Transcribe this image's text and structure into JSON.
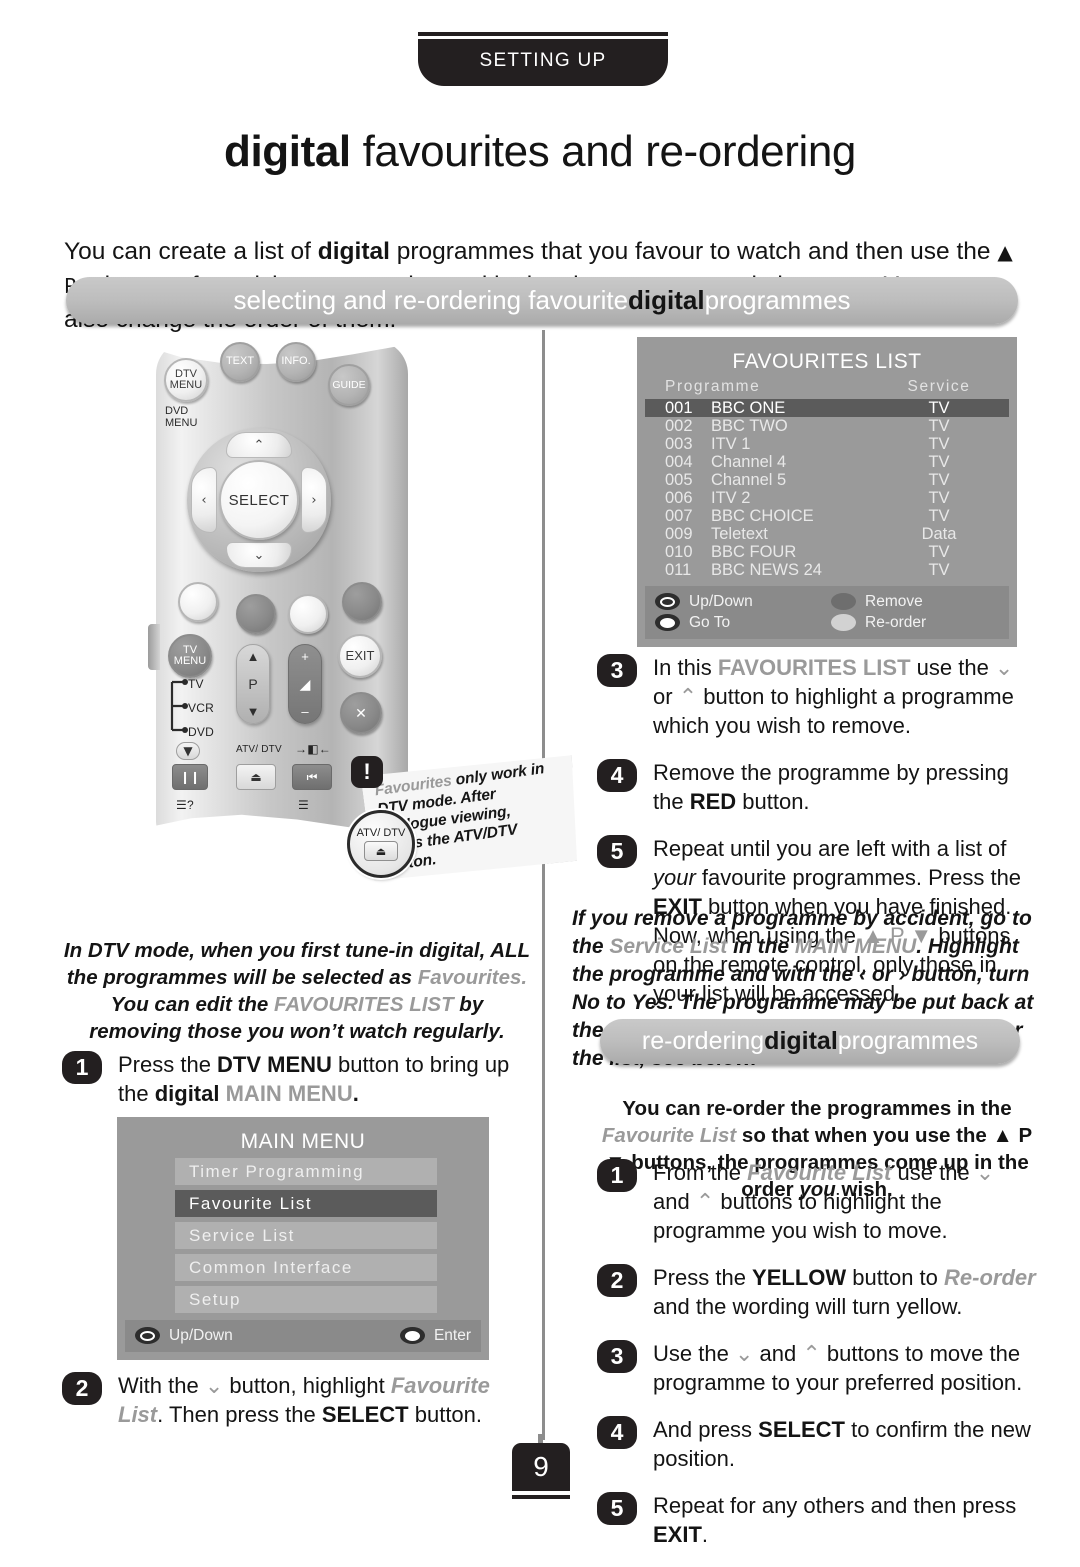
{
  "header": {
    "tab_label": "SETTING UP",
    "title_bold": "digital",
    "title_rest": " favourites and re-ordering"
  },
  "intro": {
    "line1_a": "You can create a list of ",
    "line1_bold": "digital",
    "line1_b": " programmes that you favour to watch and then use the ",
    "line1_glyph": "▲ P ▼",
    "line1_c": " buttons for quick access to them, skipping the programmes in between. You can also change the order of them."
  },
  "banners": {
    "selecting_a": "selecting and re-ordering favourite ",
    "selecting_bold": "digital",
    "selecting_b": " programmes",
    "reordering_a": "re-ordering ",
    "reordering_bold": "digital",
    "reordering_b": " programmes"
  },
  "favourites_panel": {
    "title": "FAVOURITES LIST",
    "col_programme": "Programme",
    "col_service": "Service",
    "rows": [
      {
        "num": "001",
        "name": "BBC ONE",
        "service": "TV",
        "selected": true
      },
      {
        "num": "002",
        "name": "BBC TWO",
        "service": "TV",
        "selected": false
      },
      {
        "num": "003",
        "name": "ITV 1",
        "service": "TV",
        "selected": false
      },
      {
        "num": "004",
        "name": "Channel 4",
        "service": "TV",
        "selected": false
      },
      {
        "num": "005",
        "name": "Channel 5",
        "service": "TV",
        "selected": false
      },
      {
        "num": "006",
        "name": "ITV 2",
        "service": "TV",
        "selected": false
      },
      {
        "num": "007",
        "name": "BBC CHOICE",
        "service": "TV",
        "selected": false
      },
      {
        "num": "009",
        "name": "Teletext",
        "service": "Data",
        "selected": false
      },
      {
        "num": "010",
        "name": "BBC FOUR",
        "service": "TV",
        "selected": false
      },
      {
        "num": "011",
        "name": "BBC NEWS 24",
        "service": "TV",
        "selected": false
      }
    ],
    "footer": {
      "up_down": "Up/Down",
      "go_to": "Go To",
      "remove": "Remove",
      "reorder": "Re-order",
      "remove_color": "#6e6e6e",
      "reorder_color": "#d2d2d2"
    }
  },
  "main_menu_panel": {
    "title": "MAIN MENU",
    "items": [
      {
        "label": "Timer Programming",
        "selected": false
      },
      {
        "label": "Favourite List",
        "selected": true
      },
      {
        "label": "Service List",
        "selected": false
      },
      {
        "label": "Common Interface",
        "selected": false
      },
      {
        "label": "Setup",
        "selected": false
      }
    ],
    "footer": {
      "up_down": "Up/Down",
      "enter": "Enter"
    }
  },
  "steps_remove": [
    {
      "num": "3",
      "parts": [
        {
          "t": "In this ",
          "s": "n"
        },
        {
          "t": "FAVOURITES LIST",
          "s": "gb"
        },
        {
          "t": " use the ",
          "s": "n"
        },
        {
          "t": "⌄",
          "s": "g"
        },
        {
          "t": " or ",
          "s": "n"
        },
        {
          "t": "⌃",
          "s": "g"
        },
        {
          "t": " button to highlight a programme which you wish to remove.",
          "s": "n"
        }
      ]
    },
    {
      "num": "4",
      "parts": [
        {
          "t": "Remove the programme by pressing the ",
          "s": "n"
        },
        {
          "t": "RED",
          "s": "b"
        },
        {
          "t": " button.",
          "s": "n"
        }
      ]
    },
    {
      "num": "5",
      "parts": [
        {
          "t": "Repeat until you are left with a list of ",
          "s": "n"
        },
        {
          "t": "your",
          "s": "i"
        },
        {
          "t": " favourite programmes. Press the ",
          "s": "n"
        },
        {
          "t": "EXIT",
          "s": "b"
        },
        {
          "t": " button when you have finished. Now, when using the ",
          "s": "n"
        },
        {
          "t": "▲ P ▼",
          "s": "g"
        },
        {
          "t": " buttons on the remote control, only those in your list will be accessed.",
          "s": "n"
        }
      ]
    }
  ],
  "note_service_list": [
    {
      "t": "If you remove a programme by accident, go to the ",
      "s": "n"
    },
    {
      "t": "Service List",
      "s": "gb"
    },
    {
      "t": " in the ",
      "s": "n"
    },
    {
      "t": "MAIN MENU",
      "s": "gb"
    },
    {
      "t": ". Highlight the programme and with the ",
      "s": "n"
    },
    {
      "t": "‹ or ›",
      "s": "b"
    },
    {
      "t": " button, turn ",
      "s": "n"
    },
    {
      "t": "No",
      "s": "b"
    },
    {
      "t": " to ",
      "s": "n"
    },
    {
      "t": "Yes",
      "s": "b"
    },
    {
      "t": ". The programme may be put back at the ",
      "s": "n"
    },
    {
      "t": "end",
      "s": "b"
    },
    {
      "t": " of the ",
      "s": "n"
    },
    {
      "t": "FAVOURITES LIST",
      "s": "gb"
    },
    {
      "t": ". To re-order the list, see below.",
      "s": "n"
    }
  ],
  "note_dtv": [
    {
      "t": "In DTV mode, when you first tune-in digital, ALL the programmes will be selected as ",
      "s": "n"
    },
    {
      "t": "Favourites.",
      "s": "g"
    },
    {
      "t": " You can edit the ",
      "s": "n"
    },
    {
      "t": "FAVOURITES LIST",
      "s": "g"
    },
    {
      "t": " by removing those you won’t watch regularly.",
      "s": "n"
    }
  ],
  "steps_menu": [
    {
      "num": "1",
      "parts": [
        {
          "t": "Press the ",
          "s": "n"
        },
        {
          "t": "DTV MENU",
          "s": "b"
        },
        {
          "t": " button to bring up the ",
          "s": "n"
        },
        {
          "t": "digital",
          "s": "b"
        },
        {
          "t": " ",
          "s": "n"
        },
        {
          "t": "MAIN MENU",
          "s": "gb"
        },
        {
          "t": ".",
          "s": "b"
        }
      ]
    }
  ],
  "steps_menu_2": [
    {
      "num": "2",
      "parts": [
        {
          "t": "With the ",
          "s": "n"
        },
        {
          "t": "⌄",
          "s": "g"
        },
        {
          "t": " button, highlight ",
          "s": "n"
        },
        {
          "t": "Favourite List",
          "s": "gbi"
        },
        {
          "t": ". Then press the ",
          "s": "n"
        },
        {
          "t": "SELECT",
          "s": "b"
        },
        {
          "t": " button.",
          "s": "n"
        }
      ]
    }
  ],
  "reorder_lead": [
    {
      "t": "You can re-order the programmes in the ",
      "s": "n"
    },
    {
      "t": "Favourite List",
      "s": "gbi"
    },
    {
      "t": " so that when you use the ",
      "s": "n"
    },
    {
      "t": "▲ P ▼",
      "s": "n"
    },
    {
      "t": " buttons, the programmes come up in the order ",
      "s": "n"
    },
    {
      "t": "you",
      "s": "i"
    },
    {
      "t": " wish.",
      "s": "n"
    }
  ],
  "steps_reorder": [
    {
      "num": "1",
      "parts": [
        {
          "t": "From the ",
          "s": "n"
        },
        {
          "t": "Favourite List",
          "s": "gbi"
        },
        {
          "t": " use the ",
          "s": "n"
        },
        {
          "t": "⌄",
          "s": "g"
        },
        {
          "t": " and ",
          "s": "n"
        },
        {
          "t": "⌃",
          "s": "g"
        },
        {
          "t": " buttons to highlight the programme you wish to move.",
          "s": "n"
        }
      ]
    },
    {
      "num": "2",
      "parts": [
        {
          "t": "Press the ",
          "s": "n"
        },
        {
          "t": "YELLOW",
          "s": "b"
        },
        {
          "t": " button to ",
          "s": "n"
        },
        {
          "t": "Re-order",
          "s": "gbi"
        },
        {
          "t": " and the wording will turn yellow.",
          "s": "n"
        }
      ]
    },
    {
      "num": "3",
      "parts": [
        {
          "t": "Use the ",
          "s": "n"
        },
        {
          "t": "⌄",
          "s": "g"
        },
        {
          "t": " and ",
          "s": "n"
        },
        {
          "t": "⌃",
          "s": "g"
        },
        {
          "t": " buttons to move the programme to your preferred position.",
          "s": "n"
        }
      ]
    },
    {
      "num": "4",
      "parts": [
        {
          "t": "And press ",
          "s": "n"
        },
        {
          "t": "SELECT",
          "s": "b"
        },
        {
          "t": " to confirm the new position.",
          "s": "n"
        }
      ]
    },
    {
      "num": "5",
      "parts": [
        {
          "t": "Repeat for any others and then press ",
          "s": "n"
        },
        {
          "t": "EXIT",
          "s": "b"
        },
        {
          "t": ".",
          "s": "n"
        }
      ]
    }
  ],
  "callout": {
    "bang": "!",
    "line1_light": "Favourites",
    "line1_rest": " only work in",
    "line2": "DTV mode. After",
    "line3": "analogue viewing,",
    "line4": "press the ATV/DTV",
    "line5": "button.",
    "zoom_label": "ATV/ DTV",
    "zoom_glyph": "⏏"
  },
  "remote": {
    "buttons": {
      "text": "TEXT",
      "info": "INFO.",
      "dtv_menu_l1": "DTV",
      "dtv_menu_l2": "MENU",
      "guide": "GUIDE",
      "dvd_menu_l1": "DVD",
      "dvd_menu_l2": "MENU",
      "select": "SELECT",
      "up": "⌃",
      "down": "⌄",
      "left": "‹",
      "right": "›",
      "tv_menu_l1": "TV",
      "tv_menu_l2": "MENU",
      "exit": "EXIT",
      "p": "P",
      "p_up": "▲",
      "p_down": "▼",
      "vol_plus": "+",
      "vol_minus": "–",
      "vol_mid": "◢",
      "mute": "✕",
      "src_tv": "TV",
      "src_vcr": "VCR",
      "src_dvd": "DVD",
      "atv_dtv": "ATV/ DTV",
      "eject": "⏏",
      "pause": "❙❙",
      "rewind": "⏮",
      "pip": "▼",
      "subtitle_l": "☰?",
      "subtitle_r": "☰",
      "swap": "→◧←"
    }
  },
  "page_number": "9"
}
